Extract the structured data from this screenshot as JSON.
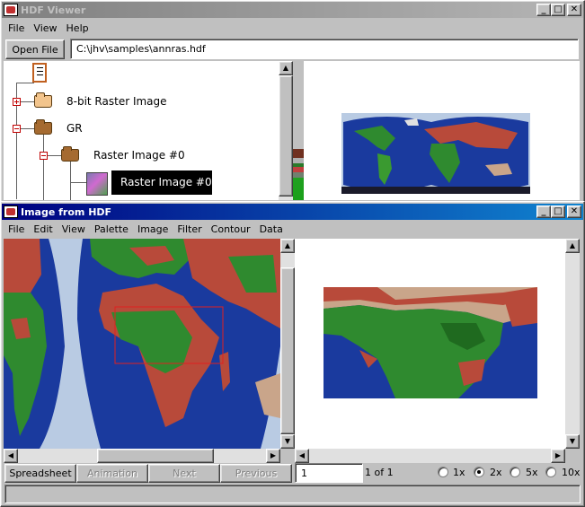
{
  "main_window": {
    "title": "HDF Viewer",
    "menu": [
      "File",
      "View",
      "Help"
    ],
    "open_file_label": "Open File",
    "file_path": "C:\\jhv\\samples\\annras.hdf",
    "tree": {
      "root_icon": "document-icon",
      "items": [
        {
          "label": "8-bit Raster Image",
          "expander": "plus"
        },
        {
          "label": "GR",
          "expander": "minus"
        },
        {
          "label": "Raster Image #0",
          "expander": "minus"
        },
        {
          "label": "Raster Image #0",
          "selected": true
        }
      ]
    }
  },
  "image_window": {
    "title": "Image from HDF",
    "menu": [
      "File",
      "Edit",
      "View",
      "Palette",
      "Image",
      "Filter",
      "Contour",
      "Data"
    ],
    "buttons": {
      "spreadsheet": "Spreadsheet",
      "animation": "Animation",
      "next": "Next",
      "previous": "Previous"
    },
    "frame_input": "1",
    "frame_count": "1 of 1",
    "zoom_options": [
      {
        "label": "1x",
        "selected": false
      },
      {
        "label": "2x",
        "selected": true
      },
      {
        "label": "5x",
        "selected": false
      },
      {
        "label": "10x",
        "selected": false
      }
    ],
    "title_buttons": {
      "minimize": "_",
      "maximize": "□",
      "close": "✕"
    }
  },
  "colors": {
    "ocean": "#1a3a9e",
    "land_green": "#2f8a2f",
    "land_red": "#b84a3a",
    "land_tan": "#c9a58a",
    "active_title": "#000080",
    "selection": "#000000"
  }
}
